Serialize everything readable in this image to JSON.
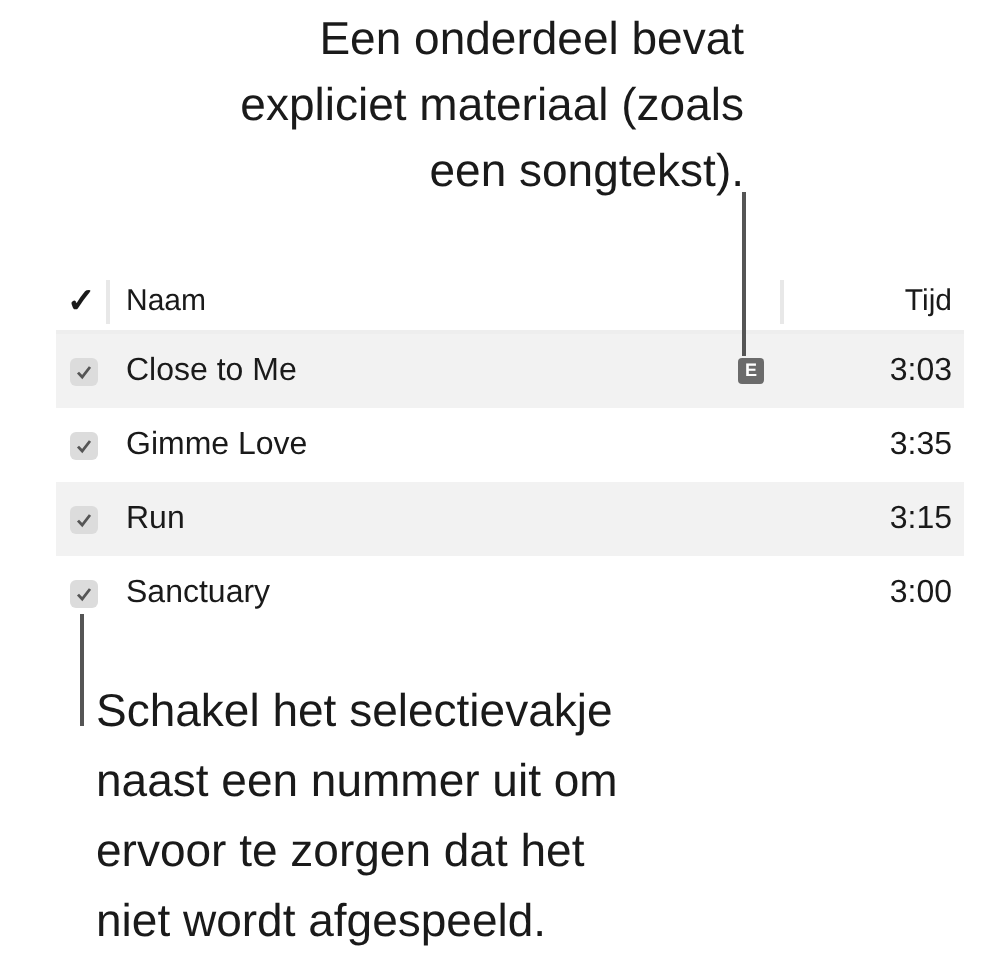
{
  "top_callout": "Een onderdeel bevat expliciet materiaal (zoals een songtekst).",
  "table": {
    "columns": [
      {
        "label": "✓"
      },
      {
        "label": "Naam"
      },
      {
        "label": "Tijd"
      }
    ],
    "rows": [
      {
        "checked": true,
        "name": "Close to Me",
        "explicit": "E",
        "time": "3:03"
      },
      {
        "checked": true,
        "name": "Gimme Love",
        "time": "3:35"
      },
      {
        "checked": true,
        "name": "Run",
        "time": "3:15"
      },
      {
        "checked": true,
        "name": "Sanctuary",
        "time": "3:00"
      }
    ]
  },
  "bottom_callout": "Schakel het selectievakje naast een nummer uit om ervoor te zorgen dat het niet wordt afgespeeld."
}
